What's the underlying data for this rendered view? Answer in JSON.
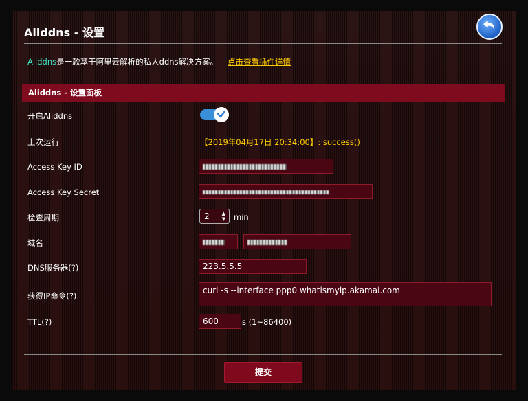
{
  "header": {
    "title": "Aliddns - 设置"
  },
  "description": {
    "brand": "Aliddns",
    "text": "是一款基于阿里云解析的私人ddns解决方案。",
    "link": "点击查看插件详情"
  },
  "section": {
    "title": "Aliddns - 设置面板"
  },
  "form": {
    "enable_label": "开启Aliddns",
    "enable_on": true,
    "lastrun_label": "上次运行",
    "lastrun_value": "【2019年04月17日 20:34:00】: success()",
    "key_id_label": "Access Key ID",
    "key_secret_label": "Access Key Secret",
    "interval_label": "检查周期",
    "interval_value": "2",
    "interval_unit": "min",
    "domain_label": "域名",
    "dns_label": "DNS服务器(?)",
    "dns_value": "223.5.5.5",
    "ipcmd_label": "获得IP命令(?)",
    "ipcmd_value": "curl -s --interface ppp0 whatismyip.akamai.com",
    "ttl_label": "TTL(?)",
    "ttl_value": "600",
    "ttl_unit": "s (1~86400)"
  },
  "actions": {
    "submit_label": "提交"
  },
  "colors": {
    "accent": "#3fe0c0",
    "warning": "#ffcc00",
    "header_band": "#7f0b1f",
    "toggle": "#3a8fd9"
  },
  "icons": {
    "back": "back-arrow-icon",
    "check": "check-icon"
  }
}
